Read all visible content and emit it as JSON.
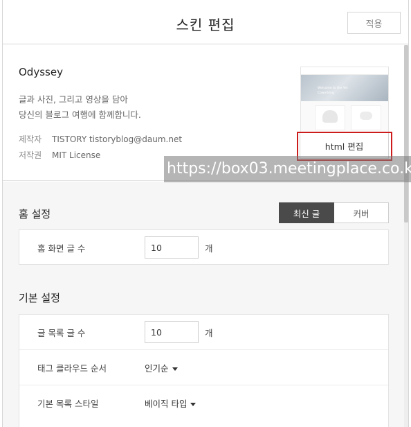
{
  "header": {
    "title": "스킨 편집",
    "apply_label": "적용"
  },
  "skin": {
    "name": "Odyssey",
    "description_line1": "글과 사진, 그리고 영상을 담아",
    "description_line2": "당신의 블로그 여행에 함께합니다.",
    "author_key": "제작자",
    "author_value": "TISTORY  tistoryblog@daum.net",
    "license_key": "저작권",
    "license_value": "MIT License",
    "html_edit_label": "html 편집",
    "thumbnail": {
      "hero_line1": "Welcome to the Yet",
      "hero_line2": "Coworking",
      "icon": "skin-preview-thumbnail"
    }
  },
  "home_settings": {
    "title": "홈 설정",
    "toggle": {
      "option1": "최신 글",
      "option2": "커버",
      "selected": "최신 글"
    },
    "rows": [
      {
        "label": "홈 화면 글 수",
        "value": "10",
        "unit": "개"
      }
    ]
  },
  "basic_settings": {
    "title": "기본 설정",
    "post_count": {
      "label": "글 목록 글 수",
      "value": "10",
      "unit": "개"
    },
    "tag_cloud": {
      "label": "태그 클라우드 순서",
      "value": "인기순"
    },
    "list_style": {
      "label": "기본 목록 스타일",
      "value": "베이직 타입"
    }
  },
  "watermark": {
    "text": "https://box03.meetingplace.co.k"
  },
  "colors": {
    "highlight": "#cc1c1c",
    "toggle_active": "#4a4a4a",
    "settings_bg": "#f6f6f6"
  }
}
